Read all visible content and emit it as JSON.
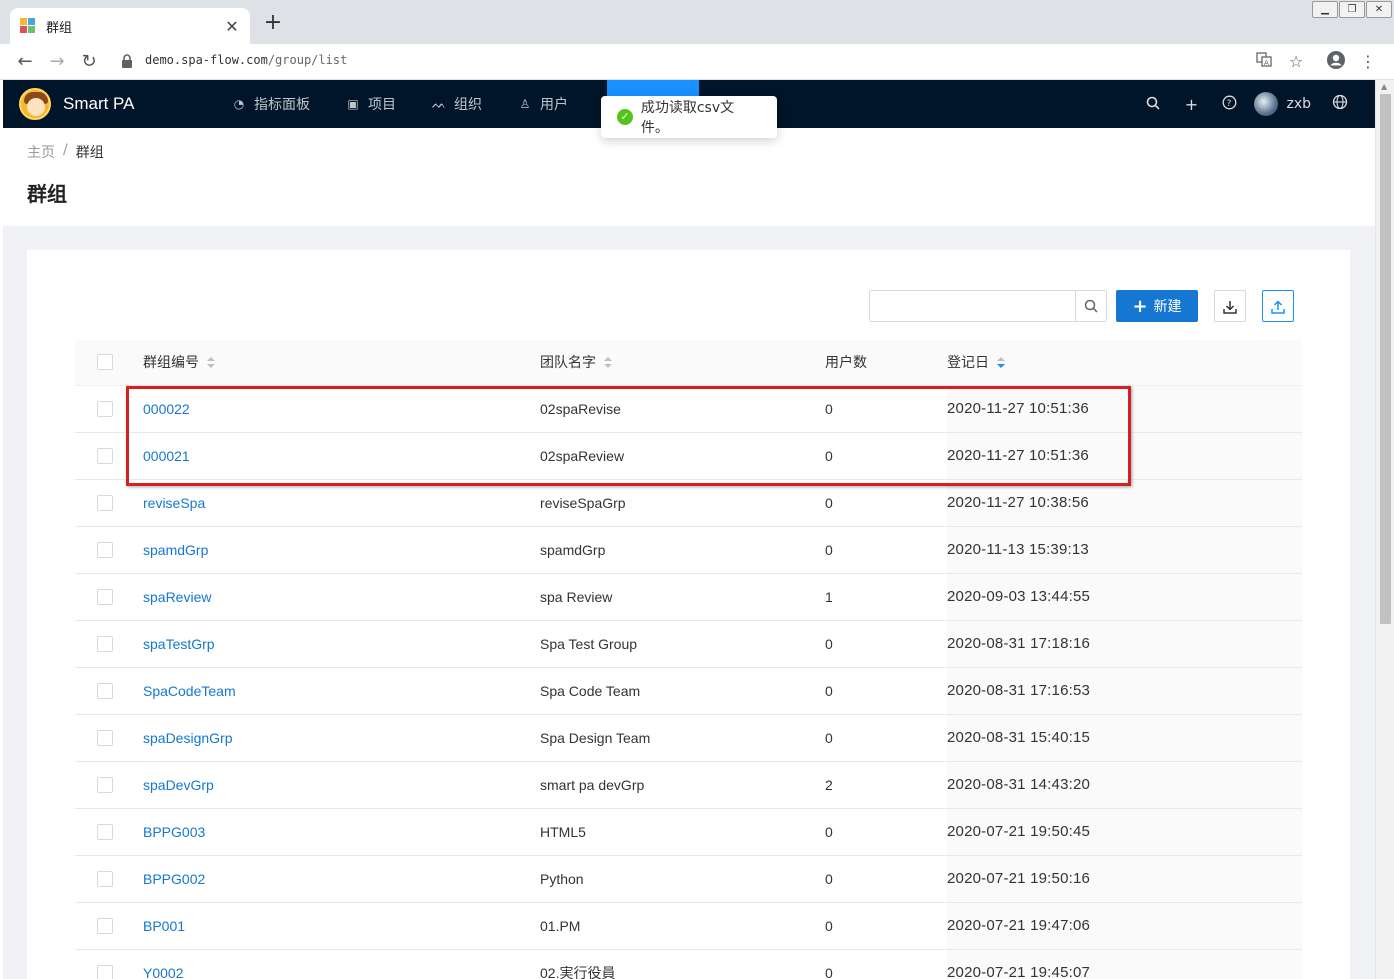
{
  "browser": {
    "tab_title": "群组",
    "url_host": "demo.spa-flow.com",
    "url_path": "/group/list"
  },
  "app": {
    "brand": "Smart PA",
    "menu": [
      {
        "label": "指标面板",
        "icon": "dashboard-icon"
      },
      {
        "label": "项目",
        "icon": "project-icon"
      },
      {
        "label": "组织",
        "icon": "organization-icon"
      },
      {
        "label": "用户",
        "icon": "user-icon"
      }
    ],
    "user_name": "zxb",
    "toast": "成功读取csv文件。"
  },
  "page": {
    "breadcrumb_home": "主页",
    "breadcrumb_sep": "/",
    "breadcrumb_current": "群组",
    "title": "群组"
  },
  "toolbar": {
    "search_placeholder": "",
    "new_label": "新建"
  },
  "table": {
    "headers": {
      "code": "群组编号",
      "team": "团队名字",
      "users": "用户数",
      "date": "登记日"
    },
    "rows": [
      {
        "code": "000022",
        "team": "02spaRevise",
        "users": "0",
        "date": "2020-11-27 10:51:36"
      },
      {
        "code": "000021",
        "team": "02spaReview",
        "users": "0",
        "date": "2020-11-27 10:51:36"
      },
      {
        "code": "reviseSpa",
        "team": "reviseSpaGrp",
        "users": "0",
        "date": "2020-11-27 10:38:56"
      },
      {
        "code": "spamdGrp",
        "team": "spamdGrp",
        "users": "0",
        "date": "2020-11-13 15:39:13"
      },
      {
        "code": "spaReview",
        "team": "spa Review",
        "users": "1",
        "date": "2020-09-03 13:44:55"
      },
      {
        "code": "spaTestGrp",
        "team": "Spa Test Group",
        "users": "0",
        "date": "2020-08-31 17:18:16"
      },
      {
        "code": "SpaCodeTeam",
        "team": "Spa Code Team",
        "users": "0",
        "date": "2020-08-31 17:16:53"
      },
      {
        "code": "spaDesignGrp",
        "team": "Spa Design Team",
        "users": "0",
        "date": "2020-08-31 15:40:15"
      },
      {
        "code": "spaDevGrp",
        "team": "smart pa devGrp",
        "users": "2",
        "date": "2020-08-31 14:43:20"
      },
      {
        "code": "BPPG003",
        "team": "HTML5",
        "users": "0",
        "date": "2020-07-21 19:50:45"
      },
      {
        "code": "BPPG002",
        "team": "Python",
        "users": "0",
        "date": "2020-07-21 19:50:16"
      },
      {
        "code": "BP001",
        "team": "01.PM",
        "users": "0",
        "date": "2020-07-21 19:47:06"
      },
      {
        "code": "Y0002",
        "team": "02.実行役員",
        "users": "0",
        "date": "2020-07-21 19:45:07"
      }
    ]
  },
  "colors": {
    "nav_bg": "#001529",
    "primary": "#1677d2",
    "highlight": "#d42020",
    "success": "#52c41a"
  }
}
